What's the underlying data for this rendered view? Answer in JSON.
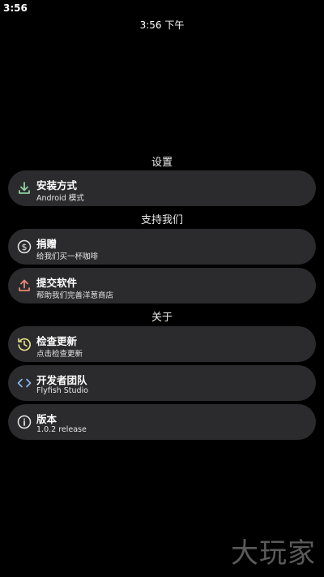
{
  "status_bar": {
    "time": "3:56"
  },
  "header": {
    "time_text": "3:56 下午"
  },
  "sections": [
    {
      "title": "设置"
    },
    {
      "title": "支持我们"
    },
    {
      "title": "关于"
    }
  ],
  "items": {
    "install": {
      "title": "安装方式",
      "subtitle": "Android 模式",
      "icon": "download-icon"
    },
    "donate": {
      "title": "捐赠",
      "subtitle": "给我们买一杯咖啡",
      "icon": "dollar-coin-icon"
    },
    "submit": {
      "title": "提交软件",
      "subtitle": "帮助我们完善洋葱商店",
      "icon": "upload-icon"
    },
    "update": {
      "title": "检查更新",
      "subtitle": "点击检查更新",
      "icon": "history-icon"
    },
    "team": {
      "title": "开发者团队",
      "subtitle": "Flyfish Studio",
      "icon": "code-icon"
    },
    "version": {
      "title": "版本",
      "subtitle": "1.0.2 release",
      "icon": "info-icon"
    }
  },
  "watermark": "大玩家",
  "colors": {
    "background": "#000000",
    "card": "#2b2b2d",
    "download_icon": "#8fd19e",
    "upload_icon": "#e8897a",
    "history_icon": "#e8e48a",
    "code_icon": "#8ab8f0"
  }
}
